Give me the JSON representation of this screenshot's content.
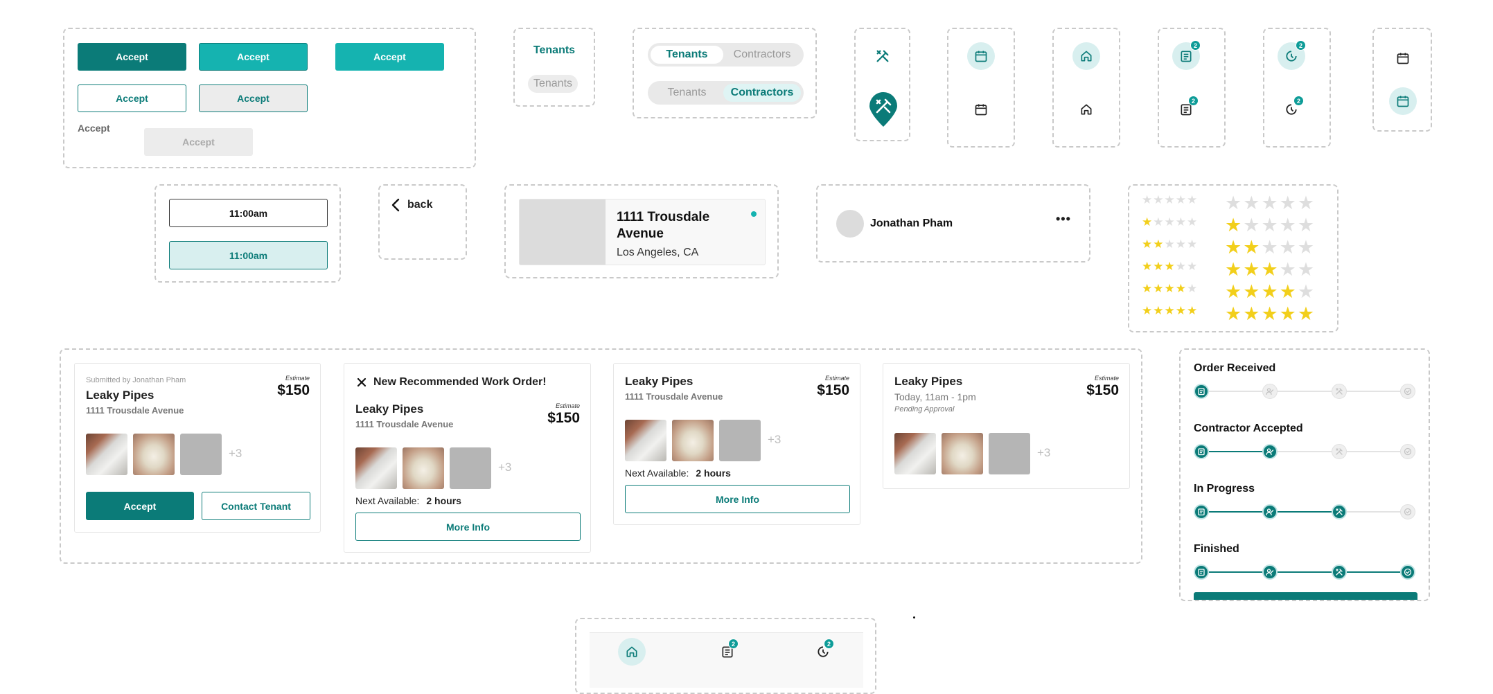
{
  "buttons": {
    "primary": "Accept",
    "primary_hover": "Accept",
    "primary_bright": "Accept",
    "secondary": "Accept",
    "secondary_pressed": "Accept",
    "text_link": "Accept",
    "disabled": "Accept"
  },
  "tabs_text": {
    "active": "Tenants",
    "inactive": "Tenants"
  },
  "segmented": [
    {
      "left": "Tenants",
      "right": "Contractors",
      "selected": "left"
    },
    {
      "left": "Tenants",
      "right": "Contractors",
      "selected": "right"
    }
  ],
  "icon_states": {
    "badge_count": "2",
    "icons": [
      "tools-icon",
      "map-pin-tools-icon",
      "calendar-icon",
      "home-icon",
      "clipboard-icon",
      "clock-icon"
    ]
  },
  "time_slots": {
    "default": "11:00am",
    "selected": "11:00am"
  },
  "back": {
    "label": "back"
  },
  "property": {
    "title": "1111 Trousdale Avenue",
    "city": "Los Angeles, CA"
  },
  "person": {
    "name": "Jonathan Pham"
  },
  "ratings": {
    "levels": [
      0,
      1,
      2,
      3,
      4,
      5
    ],
    "max": 5
  },
  "work_orders": [
    {
      "submitted_by": "Submitted by Jonathan Pham",
      "title": "Leaky Pipes",
      "address": "1111 Trousdale Avenue",
      "estimate_label": "Estimate",
      "estimate": "$150",
      "extra_images": "+3",
      "accept": "Accept",
      "contact": "Contact Tenant"
    },
    {
      "banner": "New Recommended Work Order!",
      "title": "Leaky Pipes",
      "address": "1111 Trousdale Avenue",
      "estimate_label": "Estimate",
      "estimate": "$150",
      "extra_images": "+3",
      "next_label": "Next Available:",
      "next_value": "2 hours",
      "more": "More Info"
    },
    {
      "title": "Leaky Pipes",
      "address": "1111 Trousdale Avenue",
      "estimate_label": "Estimate",
      "estimate": "$150",
      "extra_images": "+3",
      "next_label": "Next Available:",
      "next_value": "2 hours",
      "more": "More Info"
    },
    {
      "title": "Leaky Pipes",
      "schedule": "Today, 11am - 1pm",
      "status": "Pending Approval",
      "estimate_label": "Estimate",
      "estimate": "$150",
      "extra_images": "+3"
    }
  ],
  "progress": {
    "steps": [
      {
        "label": "Order Received",
        "completed": 1
      },
      {
        "label": "Contractor Accepted",
        "completed": 2
      },
      {
        "label": "In Progress",
        "completed": 3
      },
      {
        "label": "Finished",
        "completed": 4
      }
    ],
    "stage_icons": [
      "clipboard-icon",
      "worker-icon",
      "tools-icon",
      "check-icon"
    ]
  },
  "bottom_nav": {
    "items": [
      "home-icon",
      "clipboard-icon",
      "clock-icon"
    ],
    "badge_count": "2"
  },
  "colors": {
    "primary": "#0b7b78",
    "bright": "#15b3b0",
    "light": "#d8efef",
    "star": "#f2cf1b"
  }
}
